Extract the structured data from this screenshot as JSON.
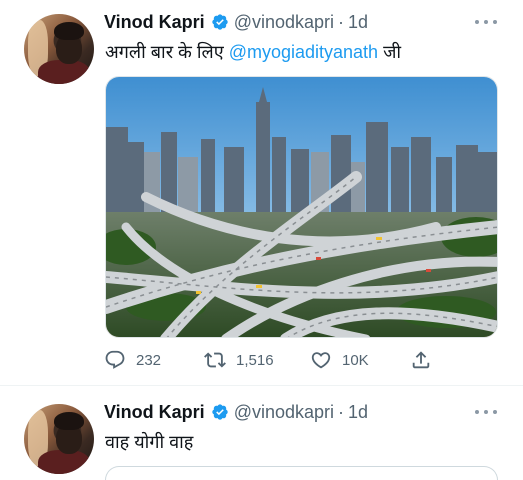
{
  "tweets": [
    {
      "name": "Vinod Kapri",
      "handle": "@vinodkapri",
      "separator": "·",
      "time": "1d",
      "text_prefix": "अगली बार के लिए ",
      "mention": "@myogiadityanath",
      "text_suffix": " जी",
      "media": "photo-city-highway-interchange",
      "actions": {
        "reply_count": "232",
        "retweet_count": "1,516",
        "like_count": "10K"
      }
    },
    {
      "name": "Vinod Kapri",
      "handle": "@vinodkapri",
      "separator": "·",
      "time": "1d",
      "text": "वाह योगी वाह"
    }
  ],
  "icons": [
    "verified-badge-icon",
    "more-icon",
    "reply-icon",
    "retweet-icon",
    "like-icon",
    "share-icon"
  ],
  "colors": {
    "accent": "#1d9bf0",
    "text_primary": "#0f1419",
    "text_secondary": "#536471",
    "divider": "#eff3f4"
  }
}
